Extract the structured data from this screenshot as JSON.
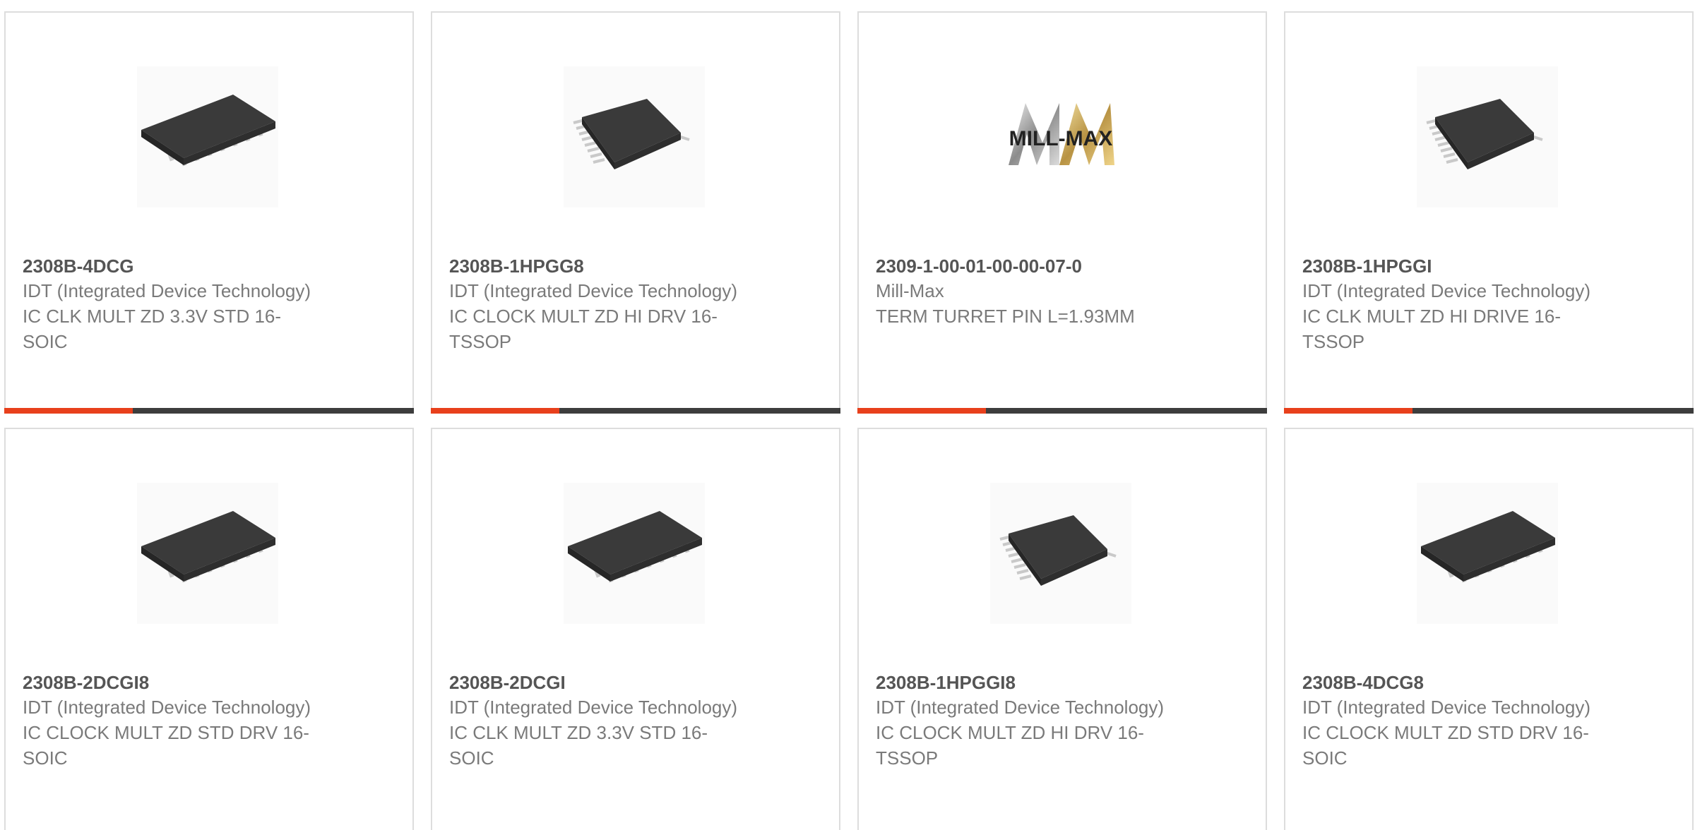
{
  "colors": {
    "accent": "#e8401c",
    "bar": "#3d3d3d",
    "border": "#dddddd"
  },
  "products": [
    {
      "part_number": "2308B-4DCG",
      "manufacturer": "IDT (Integrated Device Technology)",
      "description": "IC CLK MULT ZD 3.3V STD 16-SOIC",
      "image": "soic-chip-icon"
    },
    {
      "part_number": "2308B-1HPGG8",
      "manufacturer": "IDT (Integrated Device Technology)",
      "description": "IC CLOCK MULT ZD HI DRV 16-TSSOP",
      "image": "tssop-chip-icon"
    },
    {
      "part_number": "2309-1-00-01-00-00-07-0",
      "manufacturer": "Mill-Max",
      "description": "TERM TURRET PIN L=1.93MM",
      "image": "mill-max-logo",
      "logo_text": "MILL-MAX"
    },
    {
      "part_number": "2308B-1HPGGI",
      "manufacturer": "IDT (Integrated Device Technology)",
      "description": "IC CLK MULT ZD HI DRIVE 16-TSSOP",
      "image": "tssop-chip-icon"
    },
    {
      "part_number": "2308B-2DCGI8",
      "manufacturer": "IDT (Integrated Device Technology)",
      "description": "IC CLOCK MULT ZD STD DRV 16-SOIC",
      "image": "soic-chip-icon"
    },
    {
      "part_number": "2308B-2DCGI",
      "manufacturer": "IDT (Integrated Device Technology)",
      "description": "IC CLK MULT ZD 3.3V STD 16-SOIC",
      "image": "soic-chip-icon"
    },
    {
      "part_number": "2308B-1HPGGI8",
      "manufacturer": "IDT (Integrated Device Technology)",
      "description": "IC CLOCK MULT ZD HI DRV 16-TSSOP",
      "image": "tssop-chip-icon"
    },
    {
      "part_number": "2308B-4DCG8",
      "manufacturer": "IDT (Integrated Device Technology)",
      "description": "IC CLOCK MULT ZD STD DRV 16-SOIC",
      "image": "soic-chip-icon"
    }
  ]
}
